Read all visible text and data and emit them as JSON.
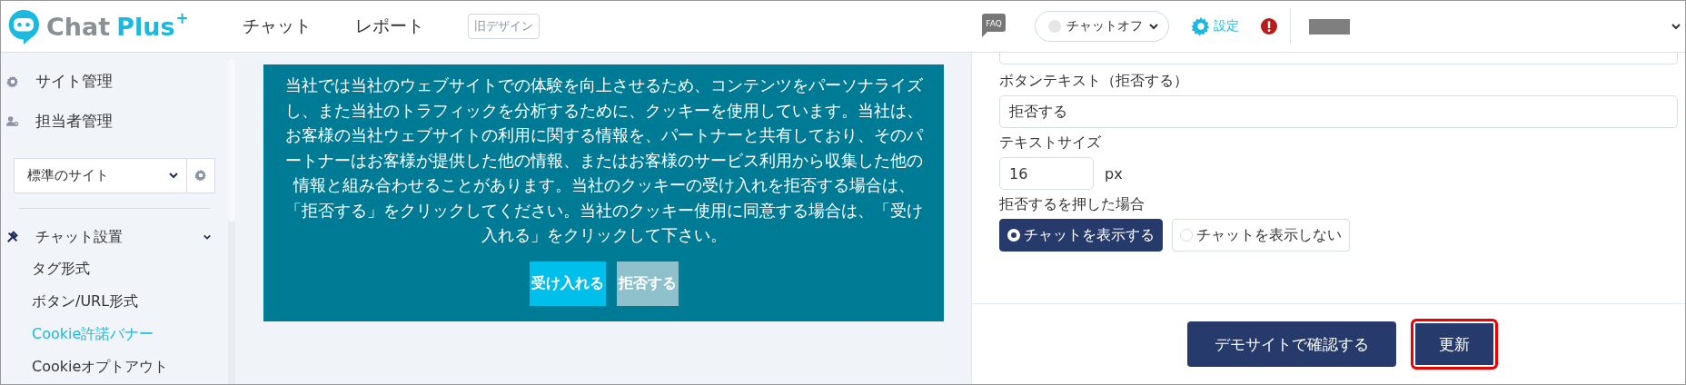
{
  "header": {
    "logo": {
      "word_1": "Chat",
      "word_2": "Plus",
      "mark": "+"
    },
    "nav": [
      {
        "label": "チャット"
      },
      {
        "label": "レポート"
      }
    ],
    "old_design_button": "旧デザイン",
    "faq": "FAQ",
    "chat_status": {
      "label": "チャットオフ",
      "on": false
    },
    "settings_link": "設定"
  },
  "sidebar": {
    "items": [
      {
        "label": "サイト管理",
        "kind": "site"
      },
      {
        "label": "担当者管理",
        "kind": "staff"
      }
    ],
    "site_select": "標準のサイト",
    "section": {
      "label": "チャット設置",
      "expanded": true,
      "children": [
        {
          "label": "タグ形式",
          "selected": false
        },
        {
          "label": "ボタン/URL形式",
          "selected": false
        },
        {
          "label": "Cookie許諾バナー",
          "selected": true
        },
        {
          "label": "Cookieオプトアウト",
          "selected": false
        }
      ]
    }
  },
  "banner": {
    "message": "当社では当社のウェブサイトでの体験を向上させるため、コンテンツをパーソナライズし、また当社のトラフィックを分析するために、クッキーを使用しています。当社は、お客様の当社ウェブサイトの利用に関する情報を、パートナーと共有しており、そのパートナーはお客様が提供した他の情報、またはお客様のサービス利用から収集した他の情報と組み合わせることがあります。当社のクッキーの受け入れを拒否する場合は、「拒否する」をクリックしてください。当社のクッキー使用に同意する場合は、「受け入れる」をクリックして下さい。",
    "buttons": [
      {
        "label": "受け入れる",
        "kind": "accept"
      },
      {
        "label": "拒否する",
        "kind": "reject"
      }
    ]
  },
  "form": {
    "reject_text": {
      "label": "ボタンテキスト（拒否する）",
      "value": "拒否する"
    },
    "text_size": {
      "label": "テキストサイズ",
      "value": "16",
      "unit": "px"
    },
    "on_reject": {
      "label": "拒否するを押した場合",
      "options": [
        {
          "label": "チャットを表示する",
          "selected": true
        },
        {
          "label": "チャットを表示しない",
          "selected": false
        }
      ]
    },
    "buttons": [
      {
        "label": "デモサイトで確認する",
        "highlighted": false
      },
      {
        "label": "更新",
        "highlighted": true
      }
    ]
  }
}
